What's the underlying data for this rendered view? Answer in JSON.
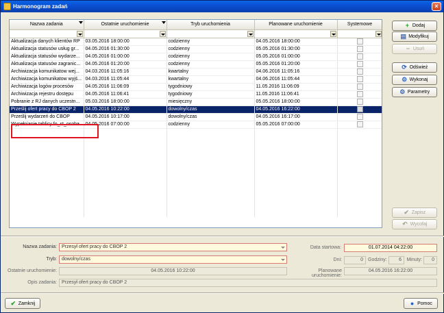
{
  "window": {
    "title": "Harmonogram zadań"
  },
  "grid": {
    "columns": [
      {
        "label": "Nazwa zadania",
        "width": 108
      },
      {
        "label": "Ostatnie uruchomienie",
        "width": 121
      },
      {
        "label": "Tryb uruchomienia",
        "width": 128
      },
      {
        "label": "Planowane uruchomienie",
        "width": 121
      },
      {
        "label": "Systemowe",
        "width": 66
      }
    ],
    "rows": [
      {
        "name": "Aktualizacja danych klientów RP",
        "last": "03.05.2016 18:00:00",
        "mode": "codzienny",
        "planned": "04.05.2016 18:00:00"
      },
      {
        "name": "Aktualizacja statusów usług gr...",
        "last": "04.05.2016 01:30:00",
        "mode": "codzienny",
        "planned": "05.05.2016 01:30:00"
      },
      {
        "name": "Aktualizacja statusów wydarze...",
        "last": "04.05.2016 01:00:00",
        "mode": "codzienny",
        "planned": "05.05.2016 01:00:00"
      },
      {
        "name": "Aktualizacja statusów zagranic...",
        "last": "04.05.2016 01:20:00",
        "mode": "codzienny",
        "planned": "05.05.2016 01:20:00"
      },
      {
        "name": "Archiwizacja komunikatow wej...",
        "last": "04.03.2016 11:05:16",
        "mode": "kwartalny",
        "planned": "04.06.2016 11:05:16"
      },
      {
        "name": "Archiwizacja komunikatow wyjś...",
        "last": "04.03.2016 11:05:44",
        "mode": "kwartalny",
        "planned": "04.06.2016 11:05:44"
      },
      {
        "name": "Archiwizacja logów procesów",
        "last": "04.05.2016 11:06:09",
        "mode": "tygodniowy",
        "planned": "11.05.2016 11:06:09"
      },
      {
        "name": "Archiwizacja rejestru dostępu",
        "last": "04.05.2016 11:06:41",
        "mode": "tygodniowy",
        "planned": "11.05.2016 11:06:41"
      },
      {
        "name": "Pobranie z RJ danych uczestn...",
        "last": "05.03.2016 18:00:00",
        "mode": "miesięczny",
        "planned": "05.05.2016 18:00:00"
      },
      {
        "name": "Prześlij ofert pracy do CBOP 2",
        "last": "04.05.2016 10:22:00",
        "mode": "dowolny/czas",
        "planned": "04.05.2016 16:22:00",
        "selected": true
      },
      {
        "name": "Prześlij wydarzeń do CBOP",
        "last": "04.05.2016 10:17:00",
        "mode": "dowolny/czas",
        "planned": "04.05.2016 16:17:00"
      },
      {
        "name": "Wypełnianie tablicy fo_st_osoba",
        "last": "04.05.2016 07:00:00",
        "mode": "codzienny",
        "planned": "05.05.2016 07:00:00"
      }
    ]
  },
  "buttons": {
    "add": "Dodaj",
    "modify": "Modyfikuj",
    "remove": "Usuń",
    "refresh": "Odśwież",
    "execute": "Wykonaj",
    "params": "Parametry",
    "save": "Zapisz",
    "revert": "Wycofaj",
    "close": "Zamknij",
    "help": "Pomoc"
  },
  "detail": {
    "name_label": "Nazwa zadania:",
    "name_value": "Przesył ofert pracy do CBOP 2",
    "mode_label": "Tryb:",
    "mode_value": "dowolny/czas",
    "last_label": "Ostatnie uruchomienie:",
    "last_value": "04.05.2016 10:22:00",
    "desc_label": "Opis zadania:",
    "desc_value": "Przesył ofert pracy do CBOP 2",
    "start_label": "Data startowa:",
    "start_value": "01.07.2014 04:22:00",
    "days_label": "Dni:",
    "days_value": "0",
    "hours_label": "Godziny:",
    "hours_value": "6",
    "minutes_label": "Minuty:",
    "minutes_value": "0",
    "planned_label": "Planowane uruchomienie:",
    "planned_value": "04.05.2016 16:22:00"
  },
  "colors": {
    "selection": "#0a246a",
    "highlight": "#e0141e",
    "required_border": "#d77a72"
  }
}
